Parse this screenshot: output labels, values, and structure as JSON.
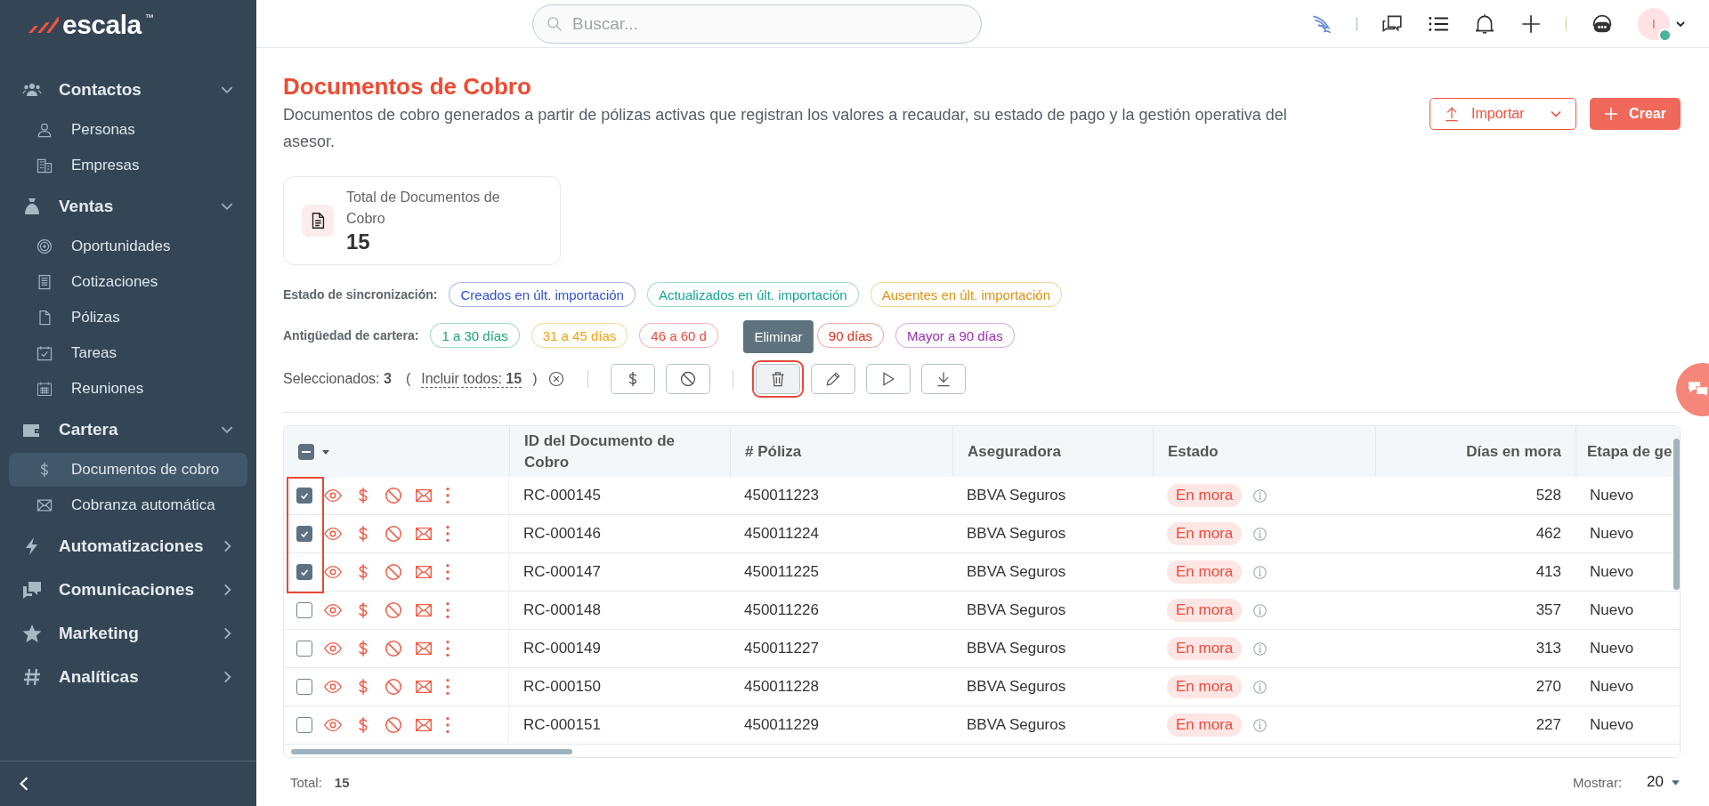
{
  "sidebar": {
    "logo": "escala",
    "logo_mark": "™",
    "sections": [
      {
        "label": "Contactos",
        "expanded": true,
        "children": [
          {
            "label": "Personas",
            "selected": false
          },
          {
            "label": "Empresas",
            "selected": false
          }
        ]
      },
      {
        "label": "Ventas",
        "expanded": true,
        "children": [
          {
            "label": "Oportunidades",
            "selected": false
          },
          {
            "label": "Cotizaciones",
            "selected": false
          },
          {
            "label": "Pólizas",
            "selected": false
          },
          {
            "label": "Tareas",
            "selected": false
          },
          {
            "label": "Reuniones",
            "selected": false
          }
        ]
      },
      {
        "label": "Cartera",
        "expanded": true,
        "children": [
          {
            "label": "Documentos de cobro",
            "selected": true
          },
          {
            "label": "Cobranza automática",
            "selected": false
          }
        ]
      },
      {
        "label": "Automatizaciones",
        "expanded": false
      },
      {
        "label": "Comunicaciones",
        "expanded": false
      },
      {
        "label": "Marketing",
        "expanded": false
      },
      {
        "label": "Analíticas",
        "expanded": false
      }
    ]
  },
  "topbar": {
    "search": {
      "placeholder": "Buscar..."
    },
    "avatar_initial": "I"
  },
  "page": {
    "title": "Documentos de Cobro",
    "description": "Documentos de cobro generados a partir de pólizas activas que registran los valores a recaudar, su estado de pago y la gestión operativa del asesor.",
    "import_button": "Importar",
    "create_button": "Crear"
  },
  "stat": {
    "label": "Total de Documentos de Cobro",
    "value": "15"
  },
  "sync_filter": {
    "label": "Estado de sincronización:",
    "chips": [
      {
        "label": "Creados en últ. importación",
        "color": "#2f4fd8"
      },
      {
        "label": "Actualizados en últ. importación",
        "color": "#16a596"
      },
      {
        "label": "Ausentes en últ. importación",
        "color": "#e0900e"
      }
    ]
  },
  "age_filter": {
    "label": "Antigüedad de cartera:",
    "chips": [
      {
        "label": "1 a 30 días",
        "color": "#1ba673"
      },
      {
        "label": "31 a 45 días",
        "color": "#f0a010"
      },
      {
        "label": "46 a 60 d",
        "color": "#ec4a3c"
      },
      {
        "label": "90 días",
        "color": "#d9321c"
      },
      {
        "label": "Mayor a 90 días",
        "color": "#9c2fb0"
      }
    ]
  },
  "selection": {
    "text": "Seleccionados: **3**",
    "open": "(",
    "include": "Incluir todos: **15**",
    "close": ")",
    "buttons": [
      {
        "hovered": false
      },
      {
        "hovered": false
      },
      {
        "hovered": true
      },
      {
        "hovered": false
      },
      {
        "hovered": false
      },
      {
        "hovered": false
      }
    ],
    "tooltip": "Eliminar"
  },
  "table": {
    "select_all_partial": true,
    "selection_outlined": true,
    "columns": [
      "ID del Documento de Cobro",
      "# Póliza",
      "Aseguradora",
      "Estado",
      "Días en mora",
      "Etapa de ge"
    ],
    "rows": [
      {
        "checked": true,
        "id": "RC-000145",
        "poliza": "450011223",
        "aseguradora": "BBVA Seguros",
        "estado": "En mora",
        "dias": "528",
        "etapa": "Nuevo"
      },
      {
        "checked": true,
        "id": "RC-000146",
        "poliza": "450011224",
        "aseguradora": "BBVA Seguros",
        "estado": "En mora",
        "dias": "462",
        "etapa": "Nuevo"
      },
      {
        "checked": true,
        "id": "RC-000147",
        "poliza": "450011225",
        "aseguradora": "BBVA Seguros",
        "estado": "En mora",
        "dias": "413",
        "etapa": "Nuevo"
      },
      {
        "checked": false,
        "id": "RC-000148",
        "poliza": "450011226",
        "aseguradora": "BBVA Seguros",
        "estado": "En mora",
        "dias": "357",
        "etapa": "Nuevo"
      },
      {
        "checked": false,
        "id": "RC-000149",
        "poliza": "450011227",
        "aseguradora": "BBVA Seguros",
        "estado": "En mora",
        "dias": "313",
        "etapa": "Nuevo"
      },
      {
        "checked": false,
        "id": "RC-000150",
        "poliza": "450011228",
        "aseguradora": "BBVA Seguros",
        "estado": "En mora",
        "dias": "270",
        "etapa": "Nuevo"
      },
      {
        "checked": false,
        "id": "RC-000151",
        "poliza": "450011229",
        "aseguradora": "BBVA Seguros",
        "estado": "En mora",
        "dias": "227",
        "etapa": "Nuevo"
      }
    ]
  },
  "footer": {
    "total_label": "Total:",
    "total": "15",
    "show_label": "Mostrar:",
    "show_value": "20"
  }
}
